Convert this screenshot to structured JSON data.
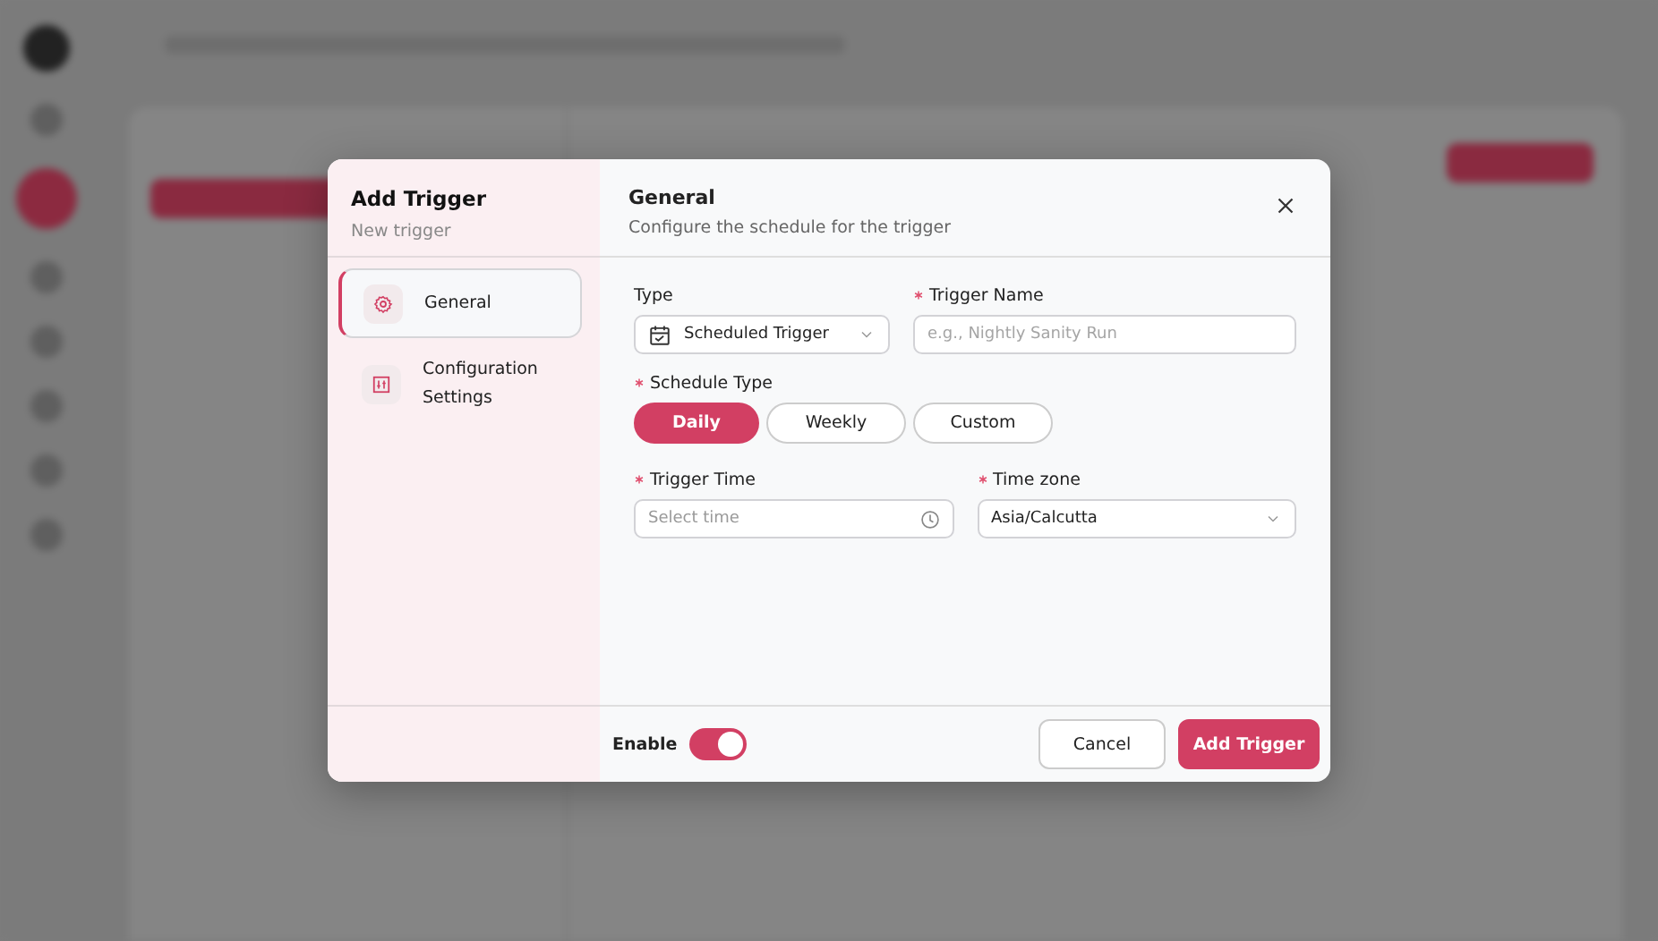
{
  "dialog": {
    "title": "Add Trigger",
    "subtitle": "New trigger",
    "steps": [
      {
        "label": "General",
        "kind": "gear",
        "selected": true
      },
      {
        "label": "Configuration Settings",
        "kind": "sliders",
        "selected": false
      }
    ],
    "section": {
      "title": "General",
      "description": "Configure the schedule for the trigger"
    },
    "rows": [
      [
        {
          "kind": "select",
          "label": "Type",
          "required": false,
          "value": "Scheduled Trigger",
          "icon": true
        },
        {
          "kind": "text",
          "label": "Trigger Name",
          "required": true,
          "placeholder": "e.g., Nightly Sanity Run"
        }
      ],
      [
        {
          "kind": "segmented",
          "label": "Schedule Type",
          "required": true,
          "options": [
            {
              "label": "Daily",
              "selected": true
            },
            {
              "label": "Weekly",
              "selected": false
            },
            {
              "label": "Custom",
              "selected": false
            }
          ]
        }
      ],
      [
        {
          "kind": "time",
          "label": "Trigger Time",
          "required": true,
          "placeholder": "Select time"
        },
        {
          "kind": "select",
          "label": "Time zone",
          "required": true,
          "value": "Asia/Calcutta",
          "icon": false
        }
      ]
    ],
    "enable": {
      "label": "Enable",
      "on": true
    },
    "buttons": [
      {
        "label": "Cancel",
        "kind": "secondary"
      },
      {
        "label": "Add Trigger",
        "kind": "primary"
      }
    ]
  }
}
